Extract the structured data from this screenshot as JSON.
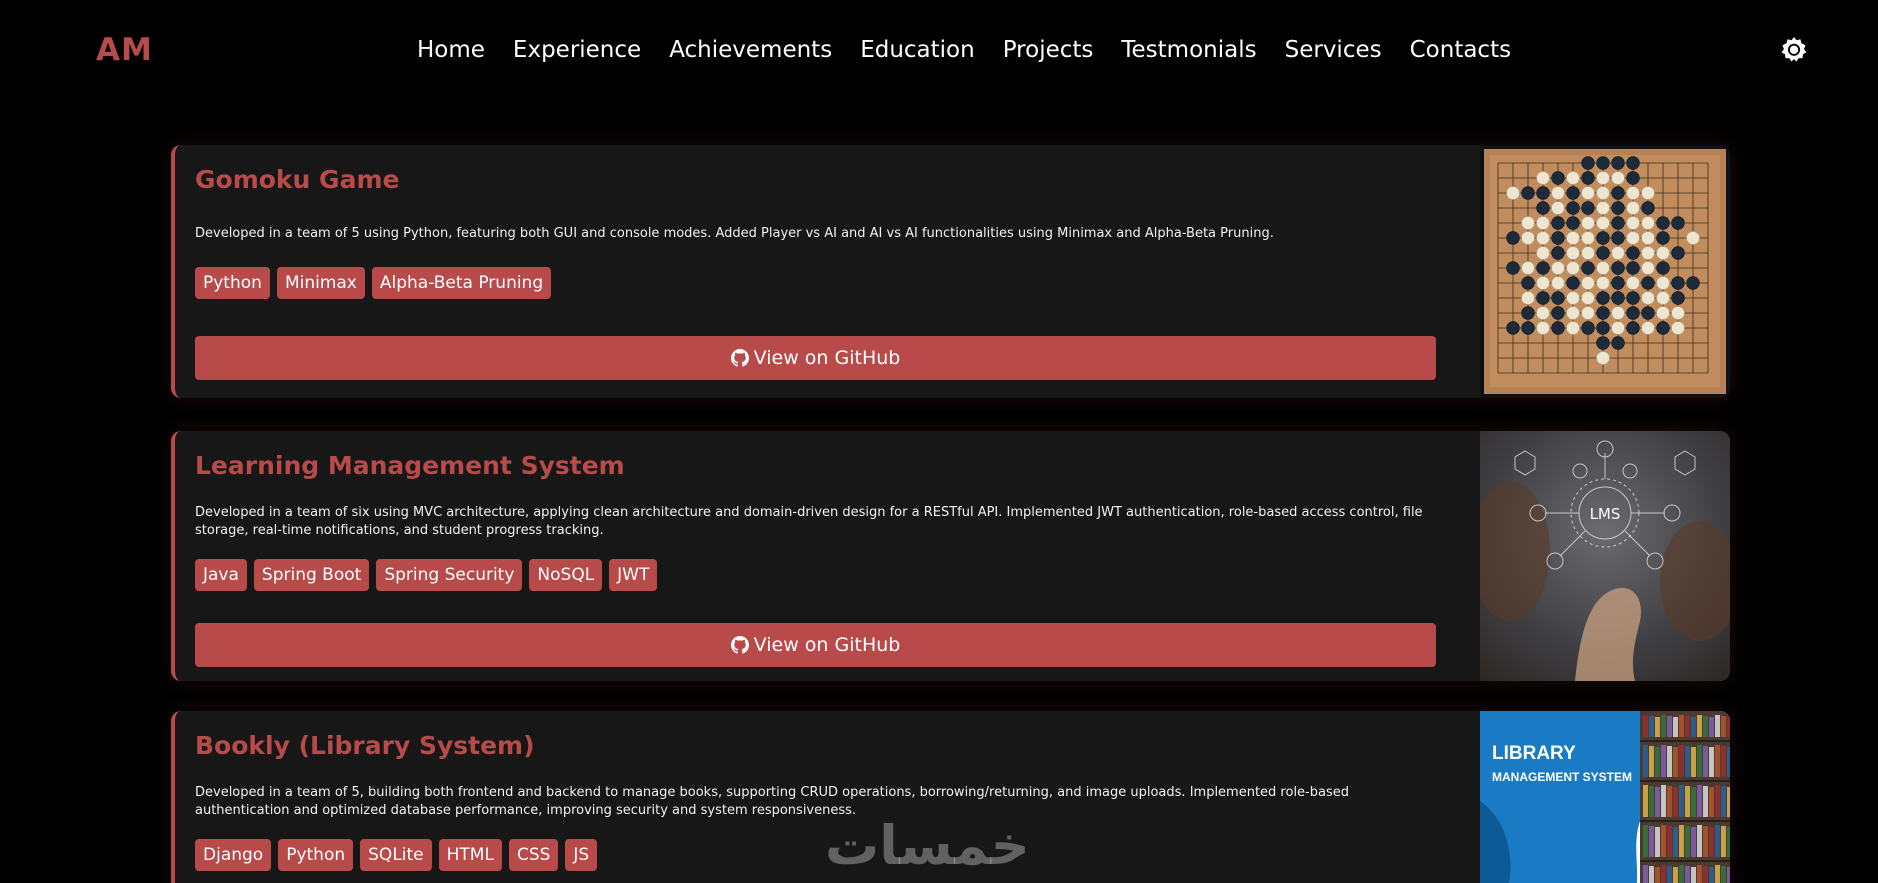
{
  "brand": {
    "logo": "AM"
  },
  "nav": {
    "items": [
      {
        "label": "Home"
      },
      {
        "label": "Experience"
      },
      {
        "label": "Achievements"
      },
      {
        "label": "Education"
      },
      {
        "label": "Projects"
      },
      {
        "label": "Testmonials"
      },
      {
        "label": "Services"
      },
      {
        "label": "Contacts"
      }
    ],
    "theme_icon": "gear-icon"
  },
  "projects": [
    {
      "title": "Gomoku Game",
      "description": "Developed in a team of 5 using Python, featuring both GUI and console modes. Added Player vs AI and AI vs AI functionalities using Minimax and Alpha-Beta Pruning.",
      "tags": [
        "Python",
        "Minimax",
        "Alpha-Beta Pruning"
      ],
      "button": "View on GitHub",
      "image_icon": "gomoku-board-image"
    },
    {
      "title": "Learning Management System",
      "description": "Developed in a team of six using MVC architecture, applying clean architecture and domain-driven design for a RESTful API. Implemented JWT authentication, role-based access control, file storage, real-time notifications, and student progress tracking.",
      "tags": [
        "Java",
        "Spring Boot",
        "Spring Security",
        "NoSQL",
        "JWT"
      ],
      "button": "View on GitHub",
      "image_icon": "lms-image",
      "image_text": "LMS"
    },
    {
      "title": "Bookly (Library System)",
      "description": "Developed in a team of 5, building both frontend and backend to manage books, supporting CRUD operations, borrowing/returning, and image uploads. Implemented role-based authentication and optimized database performance, improving security and system responsiveness.",
      "tags": [
        "Django",
        "Python",
        "SQLite",
        "HTML",
        "CSS",
        "JS"
      ],
      "image_icon": "library-system-image",
      "image_text_1": "LIBRARY",
      "image_text_2": "MANAGEMENT SYSTEM"
    }
  ],
  "watermark": "خمسات",
  "colors": {
    "accent": "#b84a4a",
    "background": "#000000",
    "card": "#171717"
  }
}
